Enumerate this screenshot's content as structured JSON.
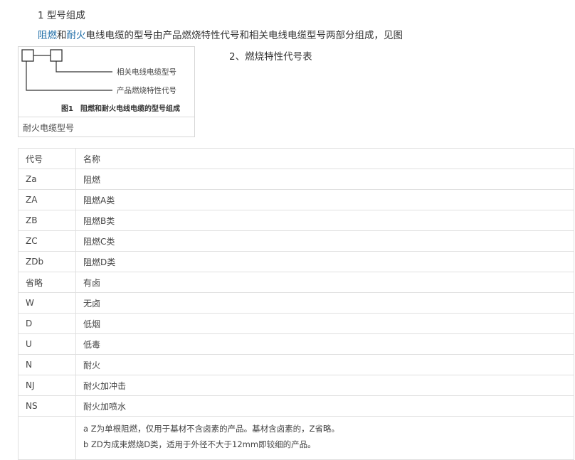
{
  "heading": "1 型号组成",
  "intro": {
    "link1": "阻燃",
    "mid": "和",
    "link2": "耐火",
    "rest": "电线电缆的型号由产品燃烧特性代号和相关电线电缆型号两部分组成，见图"
  },
  "figure": {
    "label_related": "相关电线电缆型号",
    "label_product": "产品燃烧特性代号",
    "caption": "图1　阻燃和耐火电线电缆的型号组成",
    "below_caption": "耐火电缆型号"
  },
  "side_title": "2、燃烧特性代号表",
  "table": {
    "headers": [
      "代号",
      "名称"
    ],
    "rows": [
      [
        "Za",
        "阻燃"
      ],
      [
        "ZA",
        "阻燃A类"
      ],
      [
        "ZB",
        "阻燃B类"
      ],
      [
        "ZC",
        "阻燃C类"
      ],
      [
        "ZDb",
        "阻燃D类"
      ],
      [
        "省略",
        "有卤"
      ],
      [
        "W",
        "无卤"
      ],
      [
        "D",
        "低烟"
      ],
      [
        "U",
        "低毒"
      ],
      [
        "N",
        "耐火"
      ],
      [
        "NJ",
        "耐火加冲击"
      ],
      [
        "NS",
        "耐火加喷水"
      ]
    ],
    "notes": [
      "a Z为单根阻燃，仅用于基材不含卤素的产品。基材含卤素的，Z省略。",
      "b ZD为成束燃烧D类，适用于外径不大于12mm即较细的产品。"
    ]
  }
}
